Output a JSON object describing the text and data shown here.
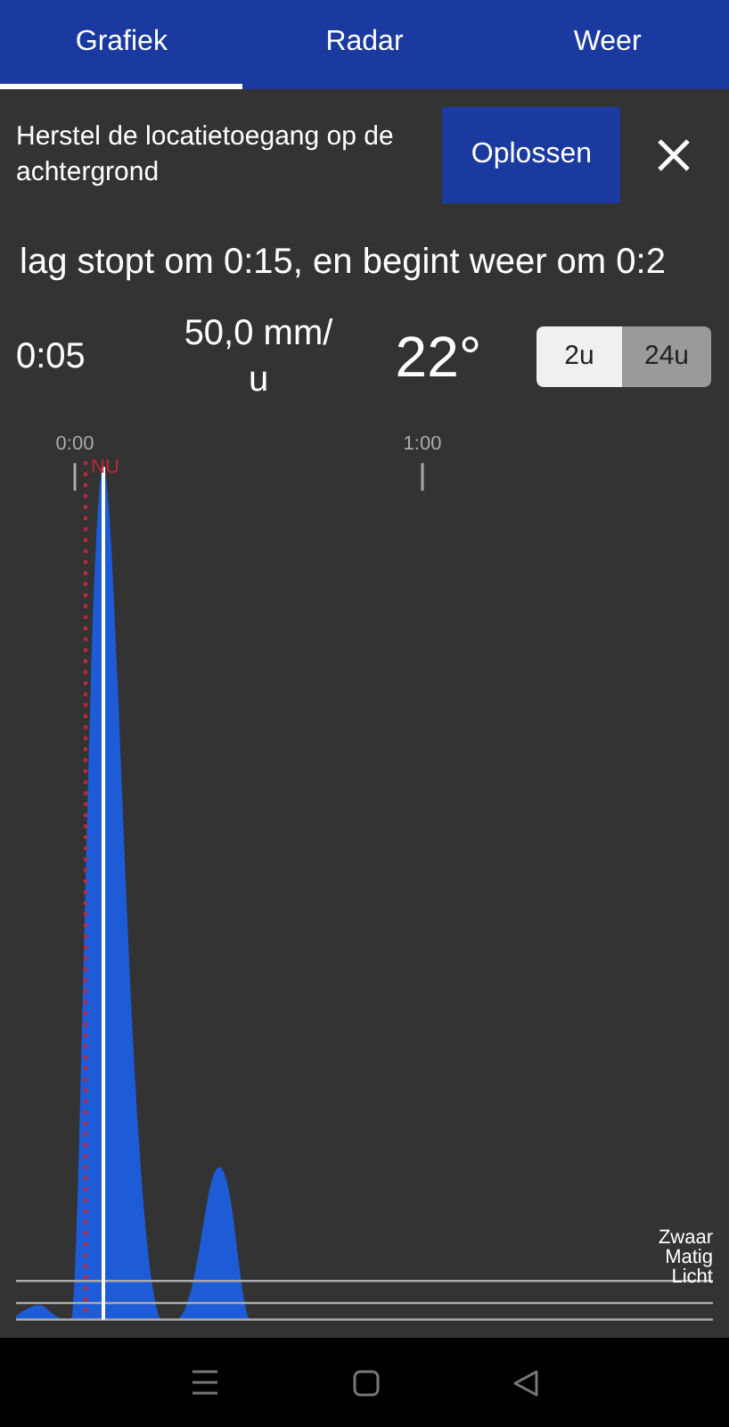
{
  "tabs": [
    {
      "label": "Grafiek",
      "selected": true
    },
    {
      "label": "Radar",
      "selected": false
    },
    {
      "label": "Weer",
      "selected": false
    }
  ],
  "banner": {
    "text": "Herstel de locatietoegang op de achtergrond",
    "button": "Oplossen"
  },
  "forecast_text": "lag stopt om 0:15, en begint weer om 0:2",
  "stats": {
    "time": "0:05",
    "intensity": "50,0 mm/u",
    "temperature": "22°"
  },
  "range_toggle": [
    {
      "label": "2u",
      "selected": true
    },
    {
      "label": "24u",
      "selected": false
    }
  ],
  "chart": {
    "x_ticks": [
      "0:00",
      "1:00"
    ],
    "now_label": "NU",
    "levels": [
      "Zwaar",
      "Matig",
      "Licht"
    ]
  }
}
